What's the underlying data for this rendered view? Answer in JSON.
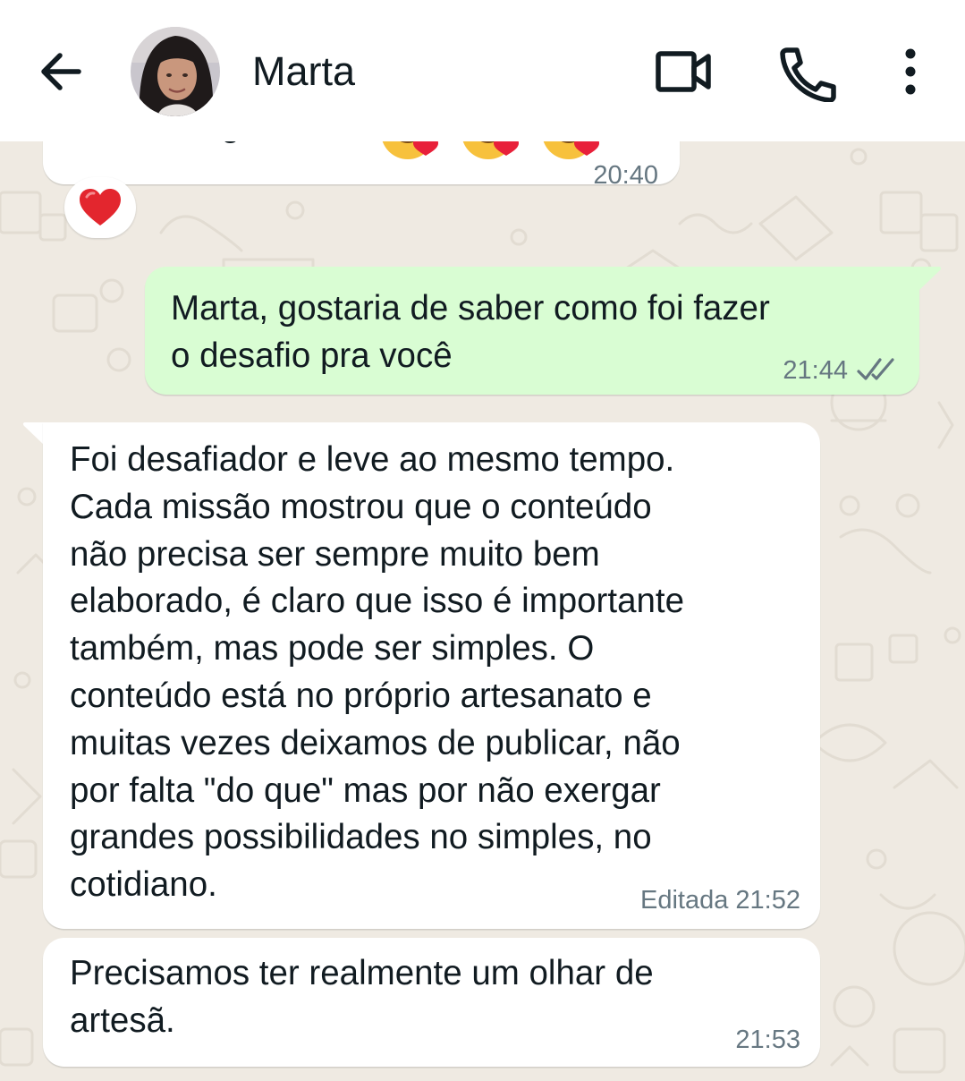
{
  "header": {
    "contact_name": "Marta",
    "icons": [
      "arrow-back-icon",
      "avatar",
      "video-call-icon",
      "phone-icon",
      "more-vert-icon"
    ]
  },
  "messages": [
    {
      "direction": "in",
      "text": "Muito obrigada!!!",
      "emojis": [
        "smiling-face-with-hearts",
        "smiling-face-with-hearts",
        "smiling-face-with-hearts"
      ],
      "time": "20:40",
      "reaction": "red-heart"
    },
    {
      "direction": "out",
      "text": "Marta, gostaria de saber como foi fazer\no desafio pra você",
      "time": "21:44",
      "status": "read"
    },
    {
      "direction": "in",
      "text": "Foi desafiador e leve ao mesmo tempo.\nCada missão mostrou que o conteúdo\nnão precisa ser sempre muito bem\nelaborado, é claro que isso é importante\ntambém, mas pode ser simples. O\nconteúdo está no próprio artesanato e\nmuitas vezes deixamos de publicar, não\npor falta \"do que\" mas por não exergar\ngrandes possibilidades no simples, no\ncotidiano.",
      "edited_label": "Editada",
      "time": "21:52"
    },
    {
      "direction": "in",
      "text": "Precisamos ter realmente um olhar de\nartesã.",
      "time": "21:53"
    }
  ],
  "colors": {
    "chat_background": "#efeae2",
    "incoming_bubble": "#ffffff",
    "outgoing_bubble": "#d9fdd3",
    "meta_text": "#667781",
    "read_ticks": "#667781"
  }
}
